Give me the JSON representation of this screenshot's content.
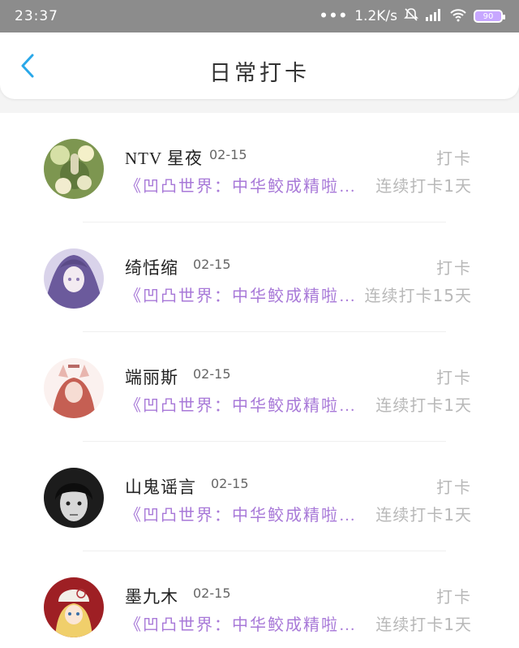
{
  "status_bar": {
    "time": "23:37",
    "network_speed": "1.2K/s",
    "battery": "90",
    "icons": [
      "dots",
      "mute-bell-icon",
      "hd-signal-icon",
      "wifi-icon",
      "battery-icon"
    ]
  },
  "header": {
    "title": "日常打卡",
    "back_icon": "chevron-left-icon",
    "accent_color": "#2aa8e9"
  },
  "items": [
    {
      "name": "NTV 星夜",
      "date": "02-15",
      "action": "打卡",
      "description": "《凹凸世界：中华鲛成精啦…",
      "streak": "连续打卡1天"
    },
    {
      "name": "绮恬缩",
      "date": "02-15",
      "action": "打卡",
      "description": "《凹凸世界：中华鲛成精啦…",
      "streak": "连续打卡15天"
    },
    {
      "name": "端丽斯",
      "date": "02-15",
      "action": "打卡",
      "description": "《凹凸世界：中华鲛成精啦…",
      "streak": "连续打卡1天"
    },
    {
      "name": "山鬼谣言",
      "date": "02-15",
      "action": "打卡",
      "description": "《凹凸世界：中华鲛成精啦…",
      "streak": "连续打卡1天"
    },
    {
      "name": "墨九木",
      "date": "02-15",
      "action": "打卡",
      "description": "《凹凸世界：中华鲛成精啦…",
      "streak": "连续打卡1天"
    }
  ],
  "colors": {
    "status_bar": "#8c8c8c",
    "description_purple": "#a879d8",
    "muted_gray": "#b8b8b8"
  }
}
